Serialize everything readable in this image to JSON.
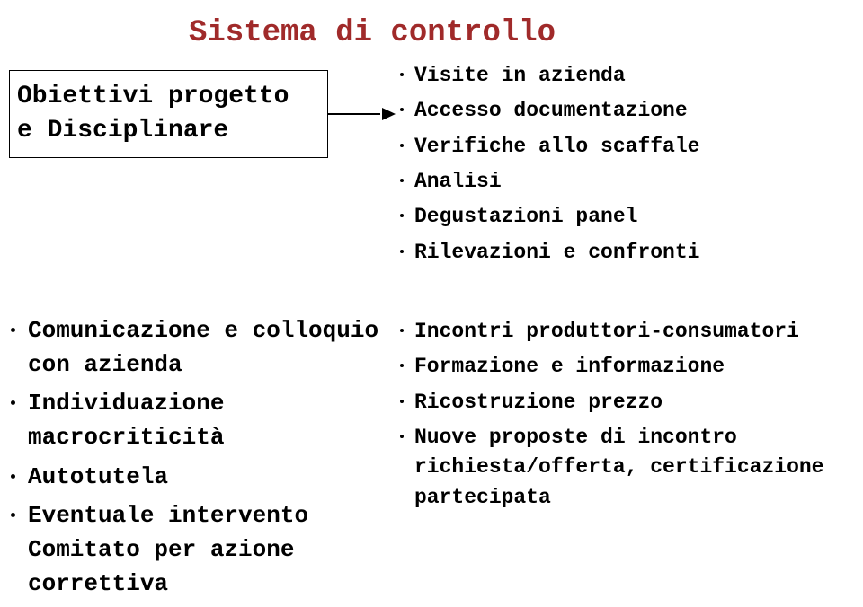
{
  "title": "Sistema di controllo",
  "box": {
    "line1": "Obiettivi progetto",
    "line2": "e Disciplinare"
  },
  "top_right": [
    "Visite in azienda",
    "Accesso documentazione",
    "Verifiche allo scaffale",
    "Analisi",
    "Degustazioni panel",
    "Rilevazioni e confronti"
  ],
  "bottom_left": [
    "Comunicazione e colloquio con azienda",
    "Individuazione macrocriticità",
    "Autotutela",
    "Eventuale intervento Comitato per azione correttiva"
  ],
  "bottom_right": [
    "Incontri produttori-consumatori",
    "Formazione e informazione",
    "Ricostruzione prezzo",
    "Nuove proposte di incontro richiesta/offerta, certificazione partecipata"
  ]
}
